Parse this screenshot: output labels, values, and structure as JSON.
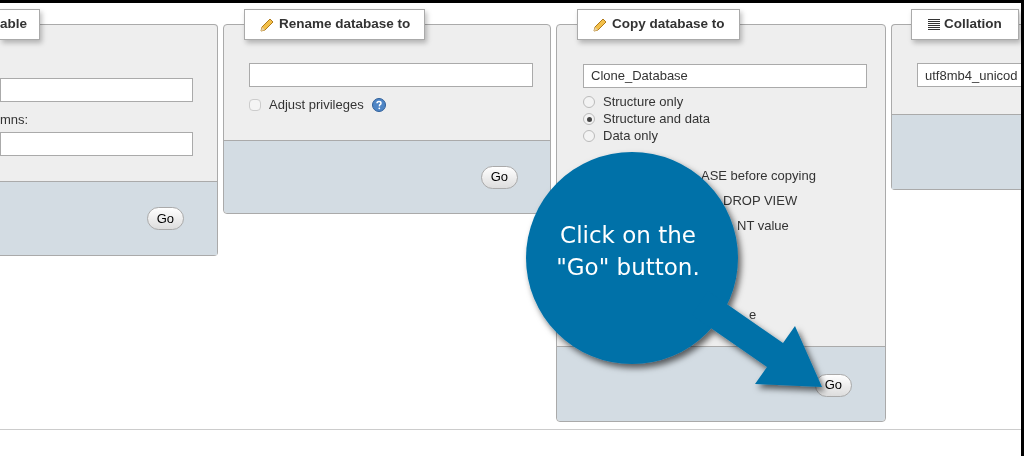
{
  "panels": [
    {
      "kind": "table",
      "legend": "able",
      "label": "mns:",
      "button": "Go"
    },
    {
      "kind": "rename",
      "legend": "Rename database to",
      "checkbox": {
        "label": "Adjust privileges",
        "checked": false
      },
      "button": "Go"
    },
    {
      "kind": "copy",
      "legend": "Copy database to",
      "value": "Clone_Database",
      "options": [
        {
          "label": "Structure only",
          "selected": false
        },
        {
          "label": "Structure and data",
          "selected": true
        },
        {
          "label": "Data only",
          "selected": false
        }
      ],
      "fragments": [
        "ASE before copying",
        "DROP VIEW",
        "NT value",
        "e"
      ],
      "button": "Go"
    },
    {
      "kind": "collation",
      "legend": "Collation",
      "value": "utf8mb4_unicod"
    }
  ],
  "callout": {
    "lines": [
      "Click on the",
      "\"Go\" button."
    ]
  }
}
